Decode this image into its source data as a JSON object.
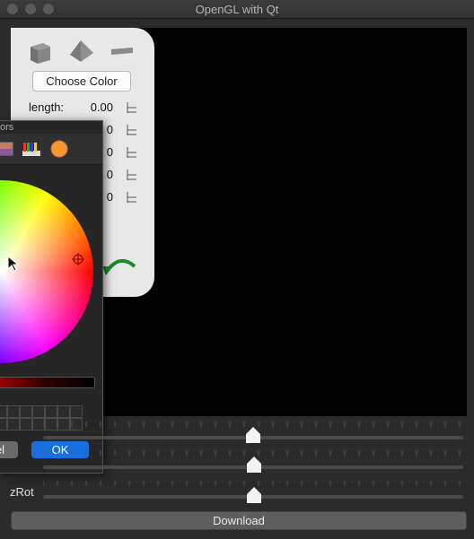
{
  "window": {
    "title": "OpenGL with Qt"
  },
  "panel": {
    "shapes": [
      "cube-icon",
      "pyramid-icon",
      "plane-icon"
    ],
    "choose_color_label": "Choose Color",
    "properties": [
      {
        "label": "length:",
        "value": "0.00"
      },
      {
        "label": "",
        "value": "0"
      },
      {
        "label": "",
        "value": "0"
      },
      {
        "label": "",
        "value": "0"
      },
      {
        "label": "",
        "value": "0"
      }
    ],
    "arrow": "curved-arrow-icon"
  },
  "color_dialog": {
    "title_partial": "ors",
    "toolbar_icons": [
      "image-palette-icon",
      "crayons-icon",
      "color-palette-icon"
    ],
    "cancel_label": "el",
    "ok_label": "OK"
  },
  "sliders": [
    {
      "label": "",
      "level": 0.5
    },
    {
      "label": "",
      "level": 0.5
    },
    {
      "label": "zRot",
      "level": 0.5
    }
  ],
  "download_label": "Download",
  "colors": {
    "accent": "#1a6fe0",
    "arrow": "#1a8a2a",
    "panel": "#e8e8e8"
  }
}
